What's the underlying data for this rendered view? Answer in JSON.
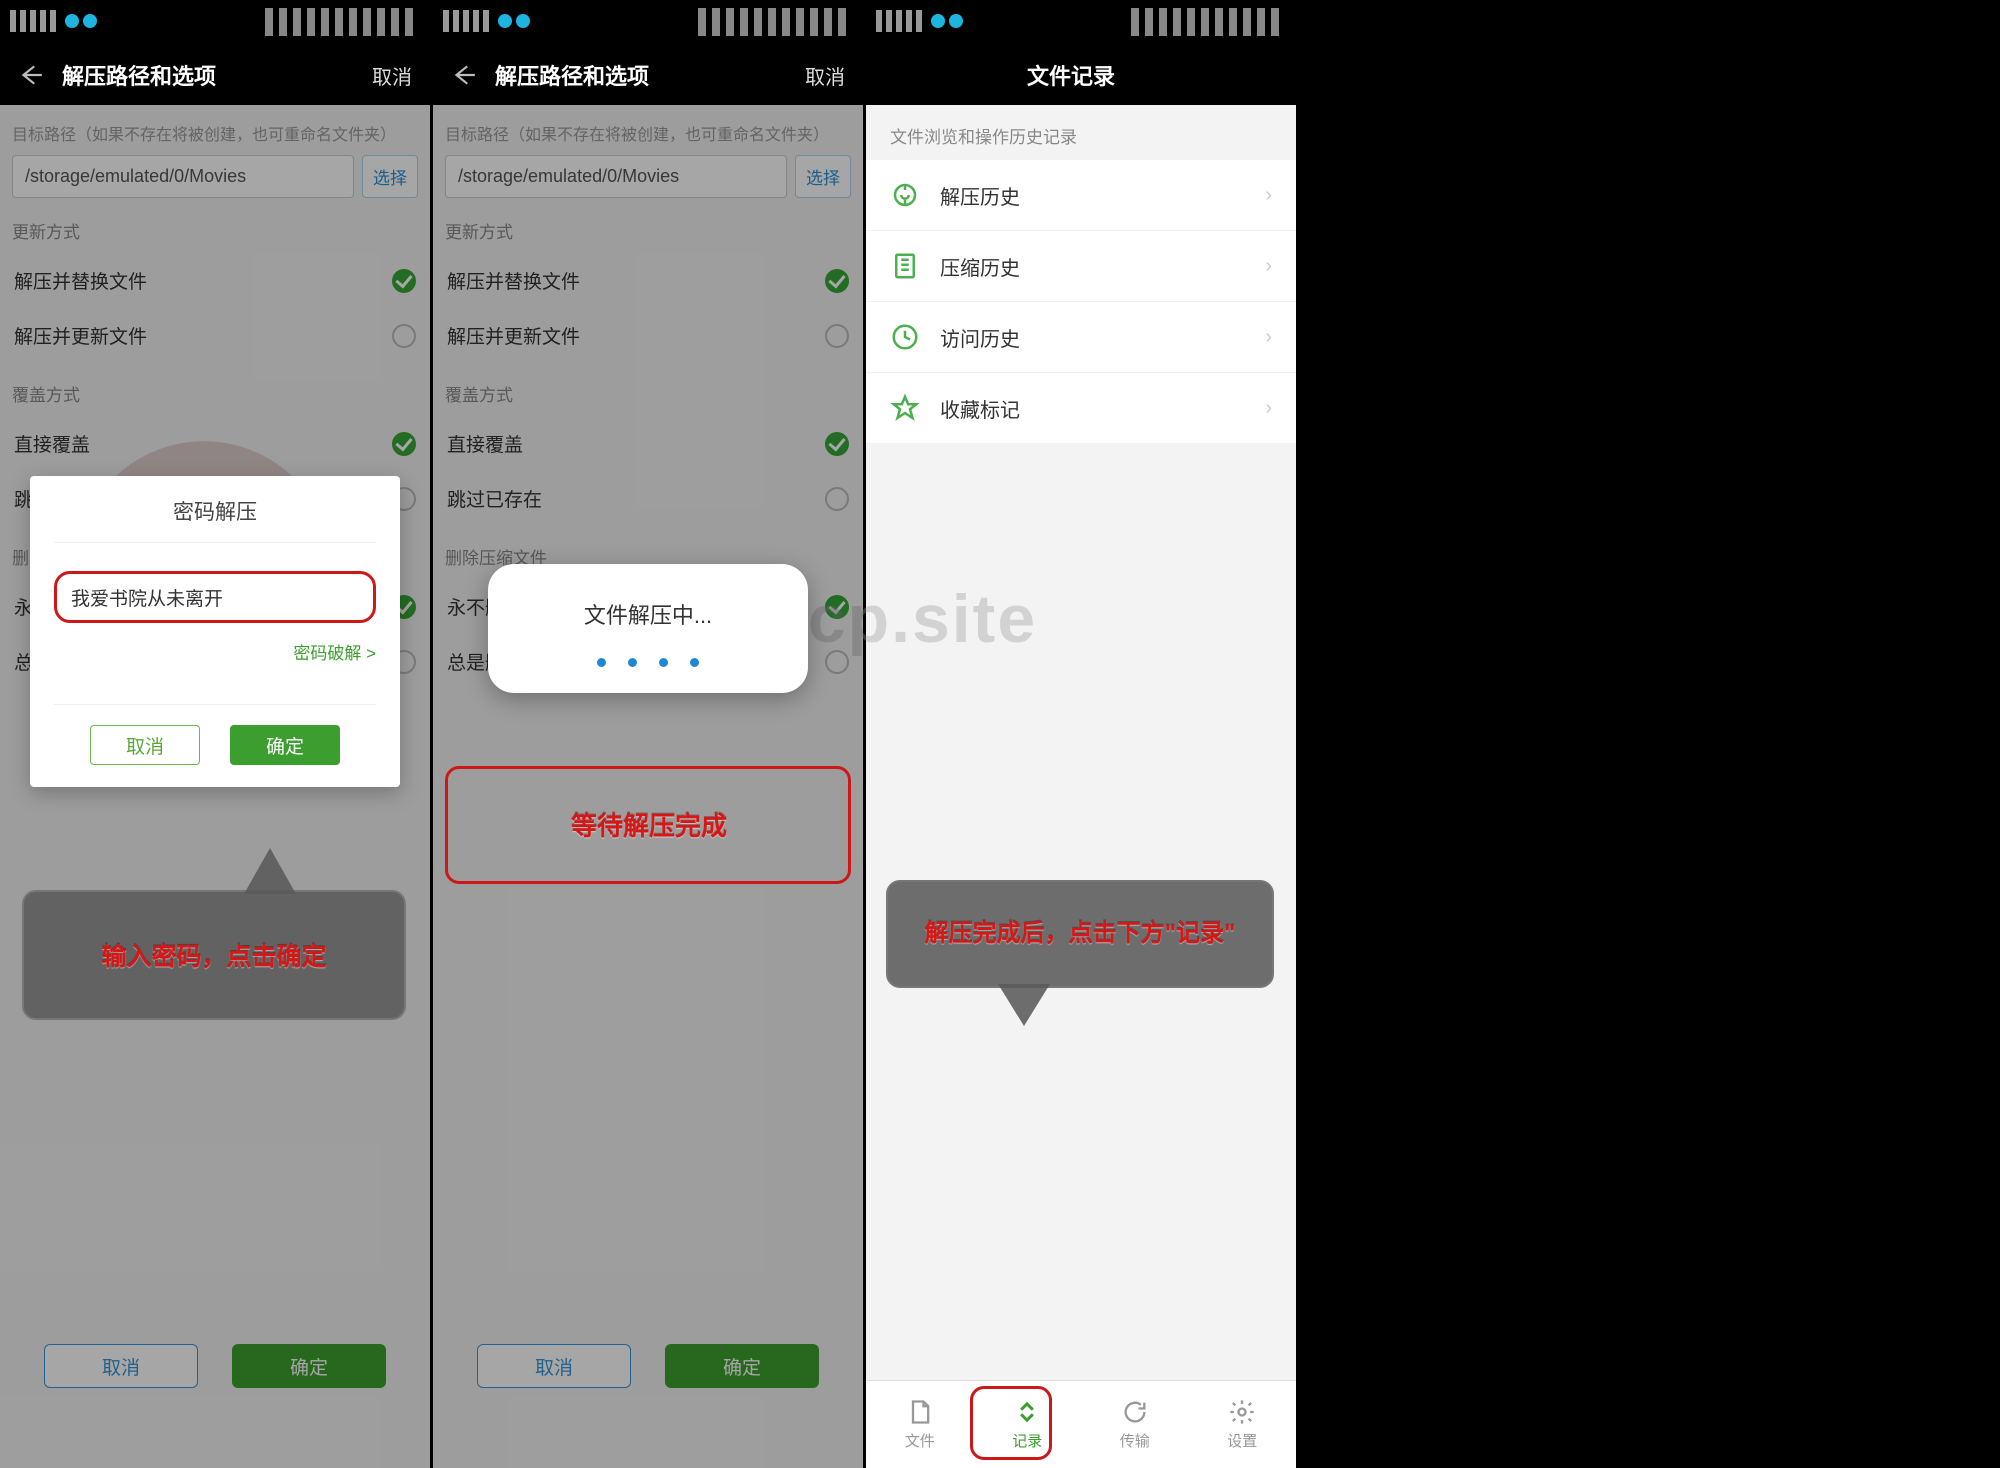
{
  "watermark_text": "www.jinricp.site",
  "screen1": {
    "header_title": "解压路径和选项",
    "header_cancel": "取消",
    "path_hint": "目标路径（如果不存在将被创建，也可重命名文件夹）",
    "path_value": "/storage/emulated/0/Movies",
    "path_select": "选择",
    "update_mode_label": "更新方式",
    "opt_replace": "解压并替换文件",
    "opt_update": "解压并更新文件",
    "overwrite_label": "覆盖方式",
    "opt_direct": "直接覆盖",
    "opt_skip": "跳过已存在",
    "delete_label": "删除压缩文件",
    "opt_never": "永不删除",
    "opt_always": "总是删除",
    "footer_cancel": "取消",
    "footer_ok": "确定",
    "dialog_title": "密码解压",
    "dialog_value": "我爱书院从未离开",
    "dialog_crack": "密码破解 >",
    "dialog_cancel": "取消",
    "dialog_ok": "确定",
    "annotation": "输入密码，点击确定"
  },
  "screen2": {
    "toast_msg": "文件解压中...",
    "annotation": "等待解压完成"
  },
  "screen3": {
    "header_title": "文件记录",
    "subtitle": "文件浏览和操作历史记录",
    "item_unzip": "解压历史",
    "item_zip": "压缩历史",
    "item_visit": "访问历史",
    "item_fav": "收藏标记",
    "nav_file": "文件",
    "nav_record": "记录",
    "nav_transfer": "传输",
    "nav_settings": "设置",
    "annotation": "解压完成后，点击下方\"记录\""
  }
}
